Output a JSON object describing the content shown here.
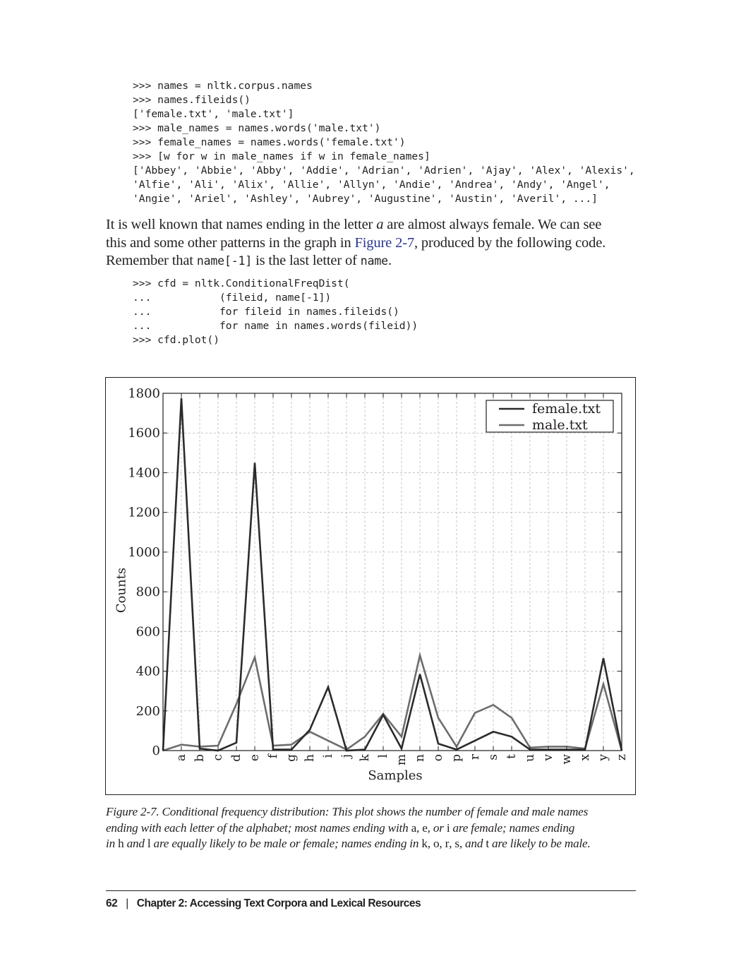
{
  "code_block_1": [
    ">>> names = nltk.corpus.names",
    ">>> names.fileids()",
    "['female.txt', 'male.txt']",
    ">>> male_names = names.words('male.txt')",
    ">>> female_names = names.words('female.txt')",
    ">>> [w for w in male_names if w in female_names]",
    "['Abbey', 'Abbie', 'Abby', 'Addie', 'Adrian', 'Adrien', 'Ajay', 'Alex', 'Alexis',",
    "'Alfie', 'Ali', 'Alix', 'Allie', 'Allyn', 'Andie', 'Andrea', 'Andy', 'Angel',",
    "'Angie', 'Ariel', 'Ashley', 'Aubrey', 'Augustine', 'Austin', 'Averil', ...]"
  ],
  "paragraph": {
    "l1_a": "It is well known that names ending in the letter ",
    "l1_em": "a",
    "l1_b": " are almost always female. We can see",
    "l2_a": "this and some other patterns in the graph in ",
    "l2_link": "Figure 2-7",
    "l2_b": ", produced by the following code.",
    "l3_a": "Remember that ",
    "l3_code1": "name[-1]",
    "l3_b": " is the last letter of ",
    "l3_code2": "name",
    "l3_c": "."
  },
  "code_block_2": [
    ">>> cfd = nltk.ConditionalFreqDist(",
    "...           (fileid, name[-1])",
    "...           for fileid in names.fileids()",
    "...           for name in names.words(fileid))",
    ">>> cfd.plot()"
  ],
  "chart_data": {
    "type": "line",
    "xlabel": "Samples",
    "ylabel": "Counts",
    "ylim": [
      0,
      1800
    ],
    "yticks": [
      0,
      200,
      400,
      600,
      800,
      1000,
      1200,
      1400,
      1600,
      1800
    ],
    "grid": true,
    "legend_position": "top-right",
    "x": [
      "",
      "a",
      "b",
      "c",
      "d",
      "e",
      "f",
      "g",
      "h",
      "i",
      "j",
      "k",
      "l",
      "m",
      "n",
      "o",
      "p",
      "r",
      "s",
      "t",
      "u",
      "v",
      "w",
      "x",
      "y",
      "z"
    ],
    "series": [
      {
        "name": "female.txt",
        "color": "#2b2b2b",
        "values": [
          0,
          1775,
          10,
          0,
          40,
          1450,
          5,
          5,
          105,
          320,
          0,
          5,
          180,
          10,
          385,
          35,
          5,
          50,
          95,
          70,
          5,
          5,
          5,
          5,
          465,
          0
        ]
      },
      {
        "name": "male.txt",
        "color": "#6d6d6d",
        "values": [
          0,
          30,
          20,
          25,
          235,
          470,
          25,
          30,
          95,
          50,
          5,
          70,
          185,
          70,
          480,
          165,
          20,
          190,
          230,
          165,
          15,
          20,
          20,
          10,
          335,
          0
        ]
      }
    ]
  },
  "caption": {
    "l1": "Figure 2-7. Conditional frequency distribution: This plot shows the number of female and male names",
    "l2_a": "ending with each letter of the alphabet; most names ending with ",
    "l2_c1": "a",
    "l2_b": ", ",
    "l2_c2": "e",
    "l2_c": ", or ",
    "l2_c3": "i",
    "l2_d": " are female; names ending",
    "l3_a": "in ",
    "l3_c1": "h",
    "l3_b": " and ",
    "l3_c2": "l",
    "l3_c": " are equally likely to be male or female; names ending in ",
    "l3_c3": "k",
    "l3_d": ", ",
    "l3_c4": "o",
    "l3_e": ", ",
    "l3_c5": "r",
    "l3_f": ", ",
    "l3_c6": "s",
    "l3_g": ", and ",
    "l3_c7": "t",
    "l3_h": " are likely to be male."
  },
  "footer": {
    "page_number": "62",
    "separator": "|",
    "chapter": "Chapter 2:  Accessing Text Corpora and Lexical Resources"
  }
}
